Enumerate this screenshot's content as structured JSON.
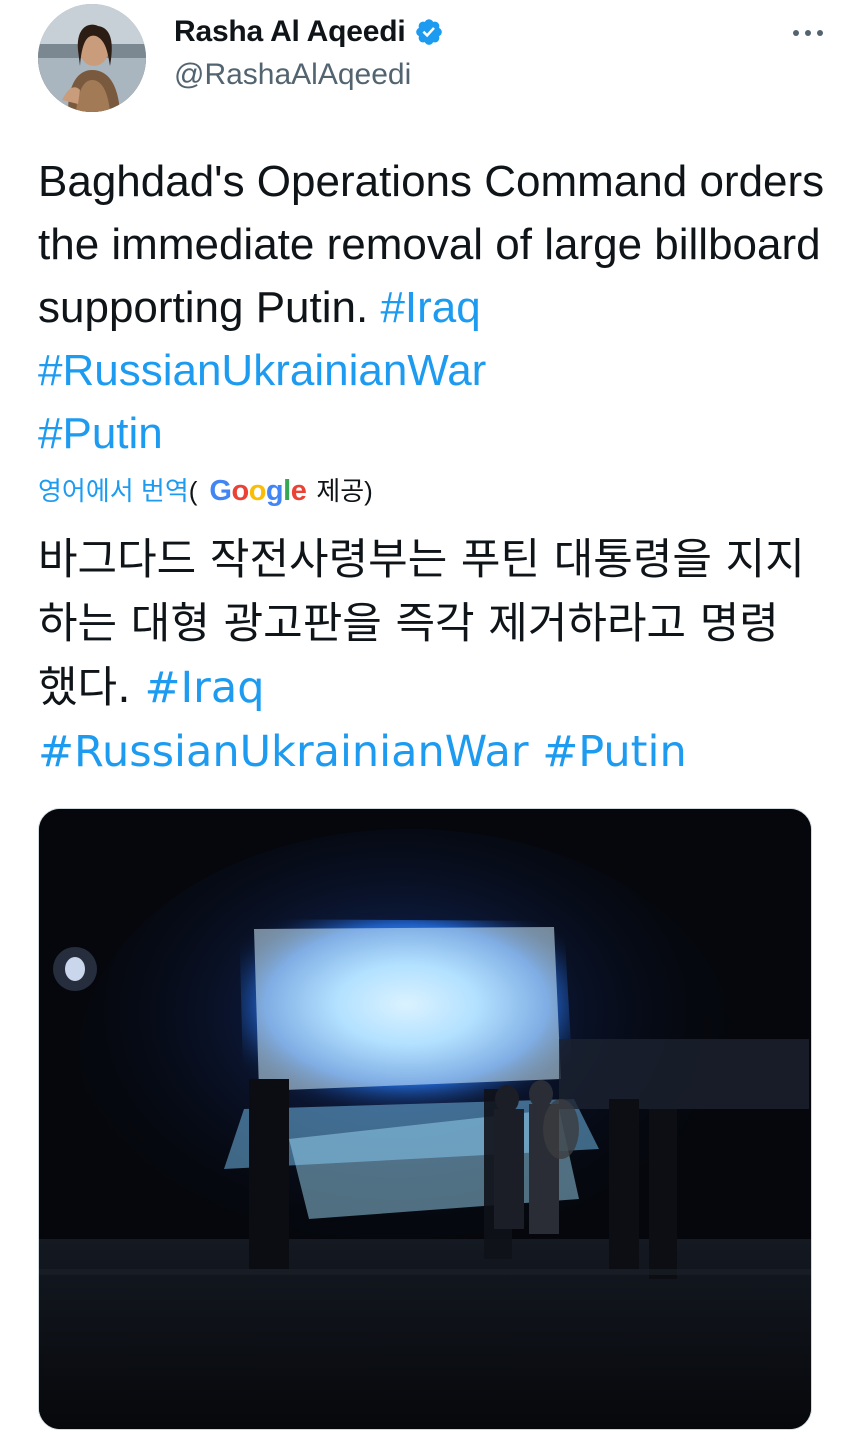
{
  "author": {
    "display_name": "Rasha Al Aqeedi",
    "handle": "@RashaAlAqeedi",
    "verified": true
  },
  "tweet": {
    "text_parts": [
      {
        "type": "text",
        "value": "Baghdad's Operations Command orders the immediate removal of large billboard supporting Putin. "
      },
      {
        "type": "hashtag",
        "value": "#Iraq"
      },
      {
        "type": "text",
        "value": " "
      },
      {
        "type": "hashtag",
        "value": "#RussianUkrainianWar"
      },
      {
        "type": "text",
        "value": " "
      },
      {
        "type": "hashtag",
        "value": "#Putin"
      }
    ]
  },
  "translation": {
    "link_label": "영어에서 번역",
    "open_paren": "(",
    "provider": "Google",
    "provided_label": "제공)",
    "text_parts": [
      {
        "type": "text",
        "value": "바그다드 작전사령부는 푸틴 대통령을 지지하는 대형 광고판을 즉각 제거하라고 명령했다. "
      },
      {
        "type": "hashtag",
        "value": "#Iraq"
      },
      {
        "type": "text",
        "value": " "
      },
      {
        "type": "hashtag",
        "value": "#RussianUkrainianWar"
      },
      {
        "type": "text",
        "value": " "
      },
      {
        "type": "hashtag",
        "value": "#Putin"
      }
    ]
  },
  "colors": {
    "text": "#0f1419",
    "secondary": "#536471",
    "link": "#1d9bf0",
    "verified": "#1d9bf0"
  },
  "icons": {
    "verified": "verified-badge-icon",
    "more": "more-options-icon"
  },
  "media": {
    "kind": "video-still",
    "scene": "night billboard"
  }
}
